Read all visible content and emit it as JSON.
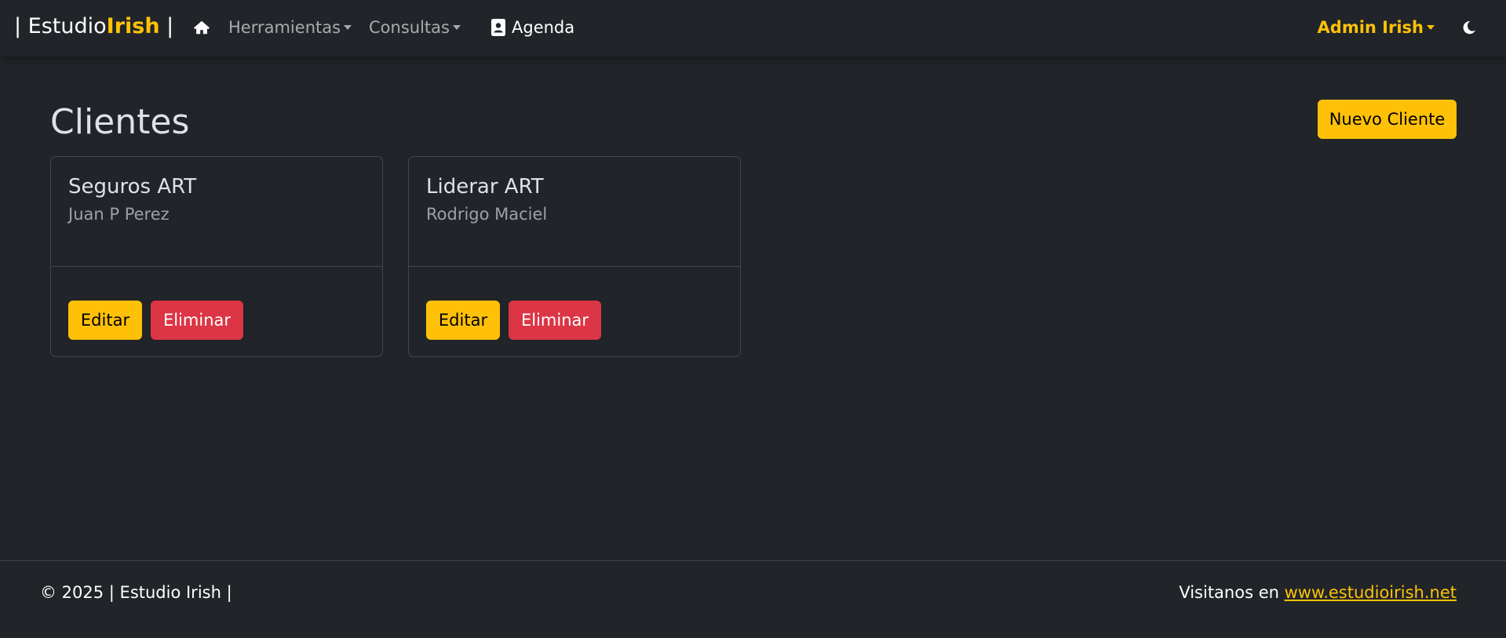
{
  "colors": {
    "background": "#212529",
    "accent": "#ffc107",
    "danger": "#dc3545",
    "text": "#dee2e6"
  },
  "navbar": {
    "brand_prefix": "| Estudio",
    "brand_accent": "Irish",
    "brand_suffix": " |",
    "home_icon": "home-icon",
    "menu_items": [
      {
        "label": "Herramientas",
        "icon": "caret-down-icon"
      },
      {
        "label": "Consultas",
        "icon": "caret-down-icon"
      }
    ],
    "agenda": {
      "label": "Agenda",
      "icon": "address-book-icon"
    },
    "user": {
      "label": "Admin Irish",
      "icon": "caret-down-icon"
    },
    "theme_icon": "moon-icon"
  },
  "main": {
    "title": "Clientes",
    "new_button": "Nuevo Cliente",
    "clients": [
      {
        "name": "Seguros ART",
        "contact": "Juan P Perez",
        "edit_label": "Editar",
        "delete_label": "Eliminar"
      },
      {
        "name": "Liderar ART",
        "contact": "Rodrigo Maciel",
        "edit_label": "Editar",
        "delete_label": "Eliminar"
      }
    ]
  },
  "footer": {
    "copyright": "© 2025 | Estudio Irish |",
    "visit_text": "Visitanos en ",
    "visit_link": "www.estudioirish.net"
  }
}
